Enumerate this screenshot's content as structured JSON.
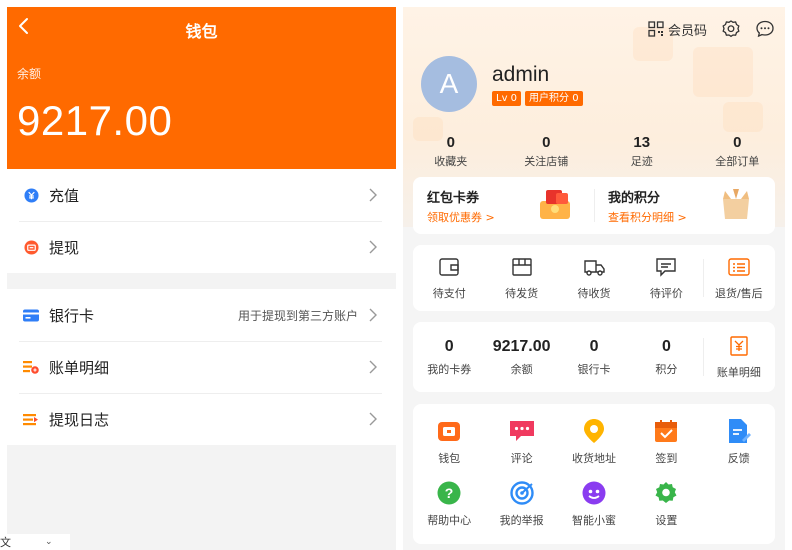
{
  "wallet": {
    "title": "钱包",
    "balance_label": "余额",
    "balance_value": "9217.00",
    "group1": [
      {
        "label": "充值",
        "icon": "recharge-icon",
        "color": "#2f7ef7"
      },
      {
        "label": "提现",
        "icon": "withdraw-icon",
        "color": "#ff5a2e"
      }
    ],
    "group2": [
      {
        "label": "银行卡",
        "hint": "用于提现到第三方账户",
        "icon": "bank-card-icon",
        "color": "#2f7ef7"
      },
      {
        "label": "账单明细",
        "hint": "",
        "icon": "bill-detail-icon",
        "color": "#ff8a00"
      },
      {
        "label": "提现日志",
        "hint": "",
        "icon": "withdraw-log-icon",
        "color": "#ff8a00"
      }
    ],
    "lang_label": "文"
  },
  "profile": {
    "member_code_label": "会员码",
    "avatar_letter": "A",
    "username": "admin",
    "level_badge": "Lv 0",
    "points_badge": "用户积分 0",
    "stats": [
      {
        "value": "0",
        "label": "收藏夹"
      },
      {
        "value": "0",
        "label": "关注店铺"
      },
      {
        "value": "13",
        "label": "足迹"
      },
      {
        "value": "0",
        "label": "全部订单"
      }
    ],
    "promo": [
      {
        "title": "红包卡券",
        "sub": "领取优惠券 >"
      },
      {
        "title": "我的积分",
        "sub": "查看积分明细 >"
      }
    ],
    "orders": [
      {
        "label": "待支付",
        "icon": "wallet-pay-icon"
      },
      {
        "label": "待发货",
        "icon": "box-icon"
      },
      {
        "label": "待收货",
        "icon": "truck-icon"
      },
      {
        "label": "待评价",
        "icon": "comment-icon"
      },
      {
        "label": "退货/售后",
        "icon": "return-icon"
      }
    ],
    "assets": [
      {
        "value": "0",
        "label": "我的卡券"
      },
      {
        "value": "9217.00",
        "label": "余额"
      },
      {
        "value": "0",
        "label": "银行卡"
      },
      {
        "value": "0",
        "label": "积分"
      },
      {
        "value": "",
        "label": "账单明细"
      }
    ],
    "services": [
      {
        "label": "钱包",
        "icon": "wallet-icon",
        "color": "#ff6a1a"
      },
      {
        "label": "评论",
        "icon": "review-icon",
        "color": "#f03a5f"
      },
      {
        "label": "收货地址",
        "icon": "location-icon",
        "color": "#ffb400"
      },
      {
        "label": "签到",
        "icon": "calendar-check-icon",
        "color": "#ff7a1a"
      },
      {
        "label": "反馈",
        "icon": "feedback-icon",
        "color": "#2f8cf7"
      },
      {
        "label": "帮助中心",
        "icon": "help-icon",
        "color": "#39b54a"
      },
      {
        "label": "我的举报",
        "icon": "report-icon",
        "color": "#2f8cf7"
      },
      {
        "label": "智能小蜜",
        "icon": "assistant-icon",
        "color": "#8a3cf0"
      },
      {
        "label": "设置",
        "icon": "settings-gear-icon",
        "color": "#39b54a"
      }
    ]
  }
}
